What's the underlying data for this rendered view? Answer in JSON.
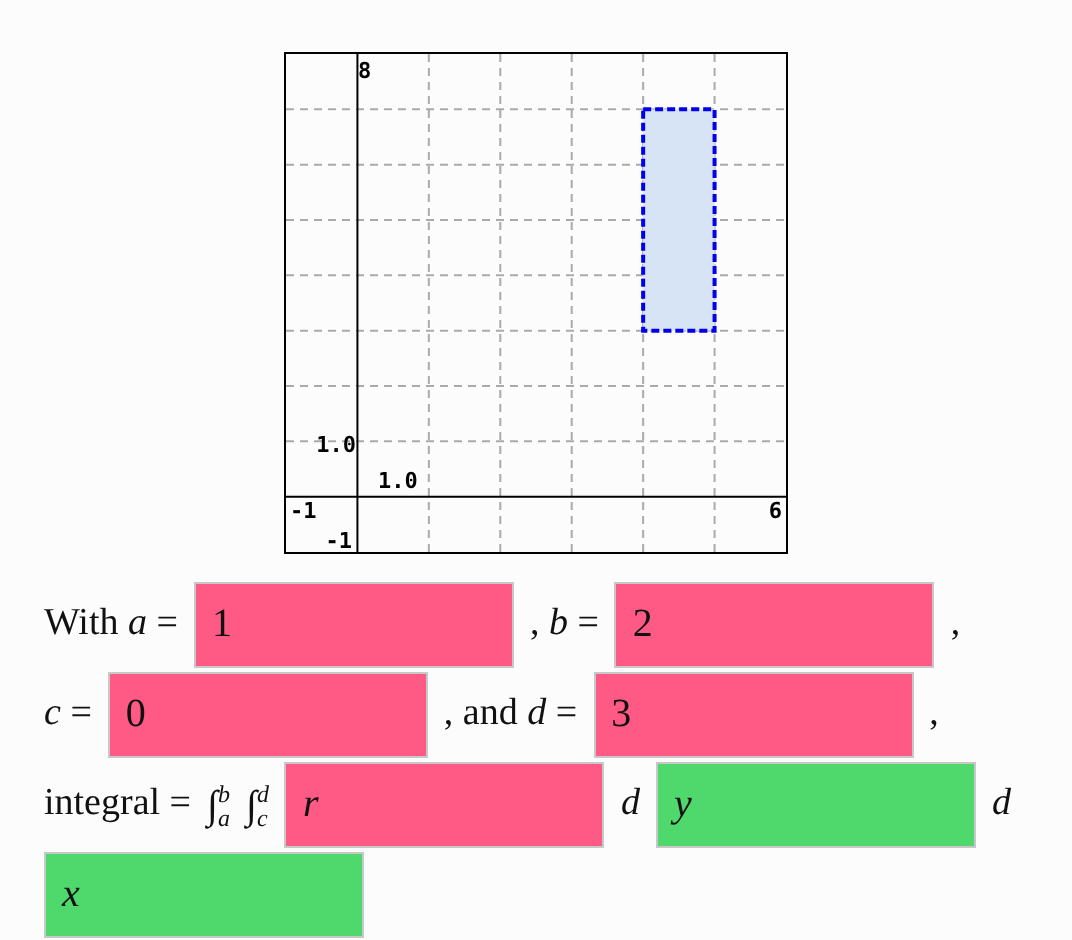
{
  "graph": {
    "labels": [
      {
        "kind": "y_max",
        "text": "8"
      },
      {
        "kind": "y_tick",
        "text": "1.0"
      },
      {
        "kind": "x_tick",
        "text": "1.0"
      },
      {
        "kind": "x_min",
        "text": "-1"
      },
      {
        "kind": "x_max",
        "text": "6"
      },
      {
        "kind": "y_min",
        "text": "-1"
      }
    ]
  },
  "lines": [
    [
      {
        "kind": "text",
        "text": "With *a* ="
      },
      {
        "kind": "field",
        "value": "1",
        "italic": false,
        "correct": false
      },
      {
        "kind": "text",
        "text": ", *b* ="
      },
      {
        "kind": "field",
        "value": "2",
        "italic": false,
        "correct": false
      },
      {
        "kind": "text",
        "text": ","
      }
    ],
    [
      {
        "kind": "text",
        "text": "*c* ="
      },
      {
        "kind": "field",
        "value": "0",
        "italic": false,
        "correct": false
      },
      {
        "kind": "text",
        "text": ", and *d* ="
      },
      {
        "kind": "field",
        "value": "3",
        "italic": false,
        "correct": false
      },
      {
        "kind": "text",
        "text": ","
      }
    ],
    [
      {
        "kind": "text",
        "text": "integral ="
      },
      {
        "kind": "integral",
        "sign": "∫",
        "lower": "a",
        "upper": "b"
      },
      {
        "kind": "integral",
        "sign": "∫",
        "lower": "c",
        "upper": "d"
      },
      {
        "kind": "field",
        "value": "r",
        "italic": true,
        "correct": false
      },
      {
        "kind": "text",
        "text": "*d*"
      },
      {
        "kind": "field",
        "value": "y",
        "italic": true,
        "correct": true
      },
      {
        "kind": "text",
        "text": "*d*"
      }
    ],
    [
      {
        "kind": "field",
        "value": "x",
        "italic": true,
        "correct": true
      }
    ]
  ]
}
